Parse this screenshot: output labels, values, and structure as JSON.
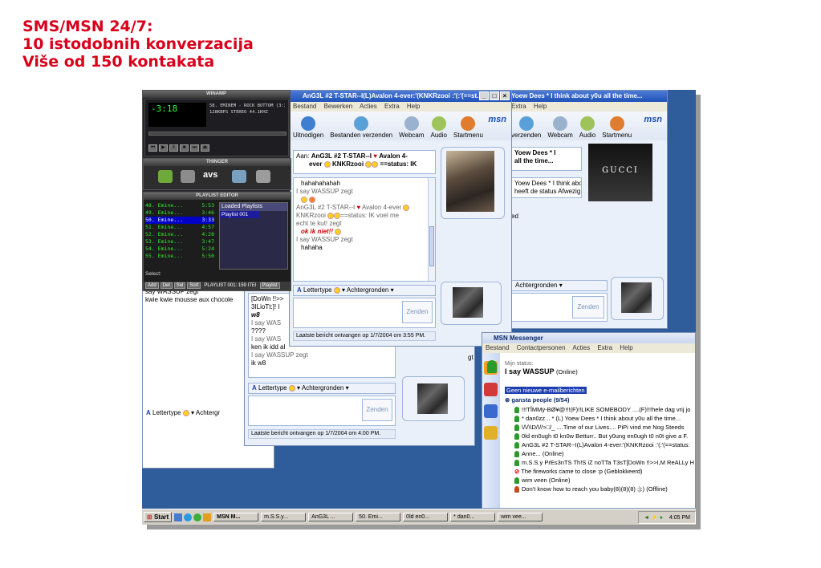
{
  "heading": {
    "line1": "SMS/MSN 24/7:",
    "line2": "10 istodobnih konverzacija",
    "line3": "Više od 150 kontakata"
  },
  "colors": {
    "heading": "#d9001b",
    "desktop": "#2f5d9c",
    "xp_title": "#2052b8"
  },
  "winamp": {
    "title": "WINAMP",
    "time": "-3:18",
    "track": "58. EMINEM - ROCK BOTTOM (3:35)",
    "bitrate": "128KBPS STEREO 44.1KHZ",
    "thinger_title": "THINGER",
    "avs_label": "avs",
    "playlist_title": "PLAYLIST EDITOR",
    "playlist": [
      {
        "n": "48.",
        "name": "Emine...",
        "len": "5:53"
      },
      {
        "n": "49.",
        "name": "Emine...",
        "len": "3:46"
      },
      {
        "n": "50.",
        "name": "Emine...",
        "len": "3:33"
      },
      {
        "n": "51.",
        "name": "Emine...",
        "len": "4:57"
      },
      {
        "n": "52.",
        "name": "Emine...",
        "len": "4:28"
      },
      {
        "n": "53.",
        "name": "Emine...",
        "len": "3:47"
      },
      {
        "n": "54.",
        "name": "Emine...",
        "len": "5:24"
      },
      {
        "n": "55.",
        "name": "Emine...",
        "len": "5:50"
      }
    ],
    "loaded_playlists": "Loaded Playlists",
    "playlist_item": "Playlist 001",
    "select_label": "Select:",
    "buttons": [
      "Add",
      "Del",
      "Sel",
      "Sort"
    ],
    "playlist_status": "PLAYLIST 001: 159 ITEI",
    "playlist_btn": "Playlist"
  },
  "chat_main": {
    "title": "AnG3L #2 T-STAR--I(L)Avalon 4-ever:'(KNKRzooi :'(:'(==st...",
    "menu": [
      "Bestand",
      "Bewerken",
      "Acties",
      "Extra",
      "Help"
    ],
    "toolbar": [
      "Uitnodigen",
      "Bestanden verzenden",
      "Webcam",
      "Audio",
      "Startmenu"
    ],
    "msn_logo": "msn",
    "to_label": "Aan:",
    "to_name": "AnG3L #2 T-STAR--I",
    "to_name2": "Avalon 4-",
    "to_name3": "ever",
    "to_name4": "KNKRzooi",
    "to_name5": "==status: IK",
    "messages": [
      {
        "text": "hahahahahah",
        "cls": ""
      },
      {
        "text": "I say WASSUP zegt",
        "cls": "gray"
      },
      {
        "text": "AnG3L #2 T-STAR--I",
        "cls": "gray"
      },
      {
        "text": "Avalon 4-ever",
        "cls": "gray"
      },
      {
        "text": "KNKRzooi",
        "cls": "gray"
      },
      {
        "text": "==status: IK voel me",
        "cls": "gray"
      },
      {
        "text": "echt te kut! zegt",
        "cls": "gray"
      },
      {
        "text": "ok ik niet!!",
        "cls": "red"
      },
      {
        "text": "I say WASSUP zegt",
        "cls": "gray"
      },
      {
        "text": "hahaha",
        "cls": ""
      }
    ],
    "font_label": "Lettertype",
    "bg_label": "Achtergronden",
    "send": "Zenden",
    "last_msg": "Laatste bericht ontvangen op 1/7/2004 om 3:55 PM."
  },
  "chat_right": {
    "title": "Yoew Dees * I think about y0u all the time...",
    "menu": [
      "Extra",
      "Help"
    ],
    "toolbar": [
      "verzenden",
      "Webcam",
      "Audio",
      "Startmenu"
    ],
    "msn_logo": "msn",
    "to_line1": "Yoew Dees * I",
    "to_line2": "all the time...",
    "msg1": "Yoew Dees * I think about",
    "msg2": "heeft de status Afwezig",
    "fragment": "ed",
    "brand": "GUCCI",
    "bg_label": "Achtergronden",
    "send": "Zenden"
  },
  "chat_mid": {
    "lines": [
      "[DoWn !!>>",
      "3ILioTt:]! I",
      "w8",
      "I say WAS",
      "????",
      "I say WAS",
      "ken ik idd al",
      "I say WASSUP zegt",
      "ik w8"
    ],
    "font_label": "Lettertype",
    "bg_label": "Achtergronden",
    "send": "Zenden",
    "last_msg": "Laatste bericht ontvangen op 1/7/2004 om 4:00 PM.",
    "fragment": "gt"
  },
  "chat_left": {
    "line1": "say WASSUP zegt",
    "line2": "kwie kwie mousse aux chocole",
    "font_label": "Lettertype",
    "bg_label": "Achtergr"
  },
  "messenger": {
    "title": "MSN Messenger",
    "menu": [
      "Bestand",
      "Contactpersonen",
      "Acties",
      "Extra",
      "Help"
    ],
    "status_label": "Mijn status:",
    "status_name": "I say WASSUP",
    "status_value": "(Online)",
    "mail": "Geen nieuwe e-mailberichten",
    "group": "gansta people (9/54)",
    "contacts": [
      {
        "text": "!!!TÎMMÿ-BØ¥@!!!(F)!!LIKE SOMEBODY ....(F)!!!hele dag vrij jo",
        "off": false
      },
      {
        "text": "*  dan0zz  .. * (L) Yoew Dees * I think about y0u all the time...",
        "off": false
      },
      {
        "text": "\\/\\/\\\\D/\\//>□/_ ....Time of our Lives.... PiPi vind me Nog Steeds",
        "off": false
      },
      {
        "text": "0ld en0ugh t0 kn0w Betturr.. But y0ung en0ugh t0 n0t give a F.",
        "off": false
      },
      {
        "text": "AnG3L #2 T-STAR--I(L)Avalon 4-ever:'(KNKRzooi :'(:'(==status:",
        "off": false
      },
      {
        "text": "Anne... (Online)",
        "off": false
      },
      {
        "text": "m.S.S.y PrEs3nTS Th!S iZ noTTa T3sT[DoWn !!>>I,M ReALLy H",
        "off": false
      },
      {
        "text": "The fireworks came to close :p (Geblokkeerd)",
        "off": true
      },
      {
        "text": "wim veen (Online)",
        "off": false
      },
      {
        "text": "Don't know how to reach you baby(8)(8)(8) ;):) (Offline)",
        "off": true
      }
    ]
  },
  "taskbar": {
    "start": "Start",
    "items": [
      "MSN M...",
      "m.S.S.y...",
      "AnG3L ...",
      "50. Emi...",
      "0ld en0...",
      "* dan0...",
      "wim vee..."
    ],
    "clock": "4:05 PM"
  }
}
